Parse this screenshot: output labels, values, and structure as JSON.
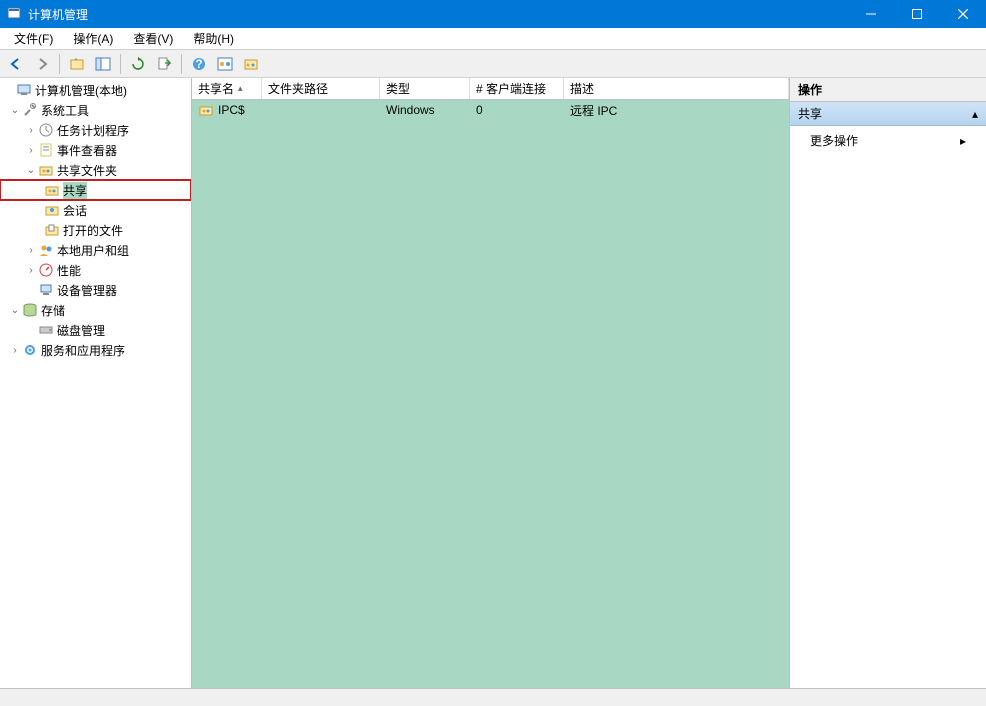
{
  "window": {
    "title": "计算机管理"
  },
  "menubar": {
    "file": "文件(F)",
    "action": "操作(A)",
    "view": "查看(V)",
    "help": "帮助(H)"
  },
  "tree": {
    "root": "计算机管理(本地)",
    "system_tools": "系统工具",
    "task_scheduler": "任务计划程序",
    "event_viewer": "事件查看器",
    "shared_folders": "共享文件夹",
    "shares": "共享",
    "sessions": "会话",
    "open_files": "打开的文件",
    "local_users": "本地用户和组",
    "performance": "性能",
    "device_manager": "设备管理器",
    "storage": "存储",
    "disk_management": "磁盘管理",
    "services_apps": "服务和应用程序"
  },
  "list": {
    "columns": {
      "share_name": "共享名",
      "folder_path": "文件夹路径",
      "type": "类型",
      "client_connections": "# 客户端连接",
      "description": "描述"
    },
    "rows": [
      {
        "share_name": "IPC$",
        "folder_path": "",
        "type": "Windows",
        "client_connections": "0",
        "description": "远程 IPC"
      }
    ]
  },
  "actions": {
    "header": "操作",
    "section": "共享",
    "more_actions": "更多操作"
  }
}
